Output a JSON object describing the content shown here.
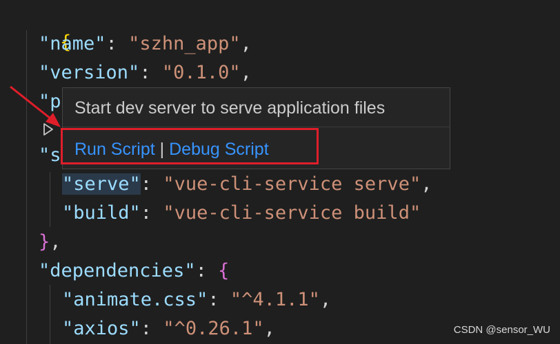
{
  "editor": {
    "lines": {
      "open_brace": "{",
      "name_key": "\"name\"",
      "name_value": "\"szhn_app\"",
      "version_key": "\"version\"",
      "version_value": "\"0.1.0\"",
      "private_key_partial": "\"p",
      "scripts_key_partial": "\"s",
      "serve_key": "\"serve\"",
      "serve_value": "\"vue-cli-service serve\"",
      "build_key": "\"build\"",
      "build_value": "\"vue-cli-service build\"",
      "scripts_close": "}",
      "dependencies_key": "\"dependencies\"",
      "dependencies_open": "{",
      "animate_key": "\"animate.css\"",
      "animate_value": "\"^4.1.1\"",
      "axios_key": "\"axios\"",
      "axios_value": "\"^0.26.1\""
    },
    "punct": {
      "colon": ":",
      "comma": ","
    }
  },
  "hover": {
    "description": "Start dev server to serve application files",
    "run_script": "Run Script",
    "separator": "|",
    "debug_script": "Debug Script"
  },
  "gutter": {
    "run_icon": "play-outline-icon"
  },
  "annotation": {
    "color": "#e01e2a"
  },
  "watermark": "CSDN @sensor_WU"
}
